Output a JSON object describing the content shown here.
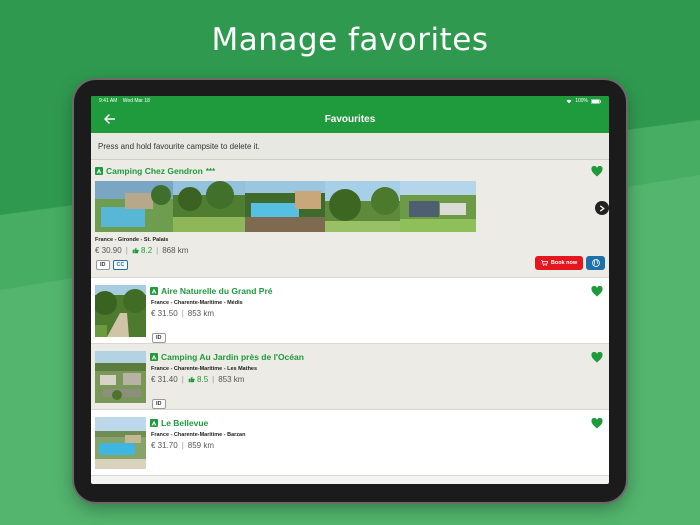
{
  "headline": "Manage favorites",
  "status": {
    "time": "9:41 AM",
    "date": "Wed Mar 18",
    "battery": "100%"
  },
  "appbar": {
    "title": "Favourites"
  },
  "hint": "Press and hold favourite campsite to delete it.",
  "colors": {
    "brand_green": "#1f9a3c",
    "book_red": "#e5161d",
    "web_blue": "#1f6fa8"
  },
  "campsites": [
    {
      "name": "Camping Chez Gendron",
      "stars": "***",
      "location": "France - Gironde - St. Palais",
      "price": "€ 30.90",
      "rating": "8.2",
      "distance": "868 km",
      "badges": [
        "ID",
        "CC"
      ],
      "book_label": "Book now"
    },
    {
      "name": "Aire Naturelle du Grand Pré",
      "location": "France - Charente-Maritime - Médis",
      "price": "€ 31.50",
      "distance": "853 km",
      "badges": [
        "ID"
      ]
    },
    {
      "name": "Camping Au Jardin près de l'Océan",
      "location": "France - Charente-Maritime - Les Mathes",
      "price": "€ 31.40",
      "rating": "8.5",
      "distance": "853 km",
      "badges": [
        "ID"
      ]
    },
    {
      "name": "Le Bellevue",
      "location": "France - Charente-Maritime - Barzan",
      "price": "€ 31.70",
      "distance": "859 km"
    }
  ]
}
